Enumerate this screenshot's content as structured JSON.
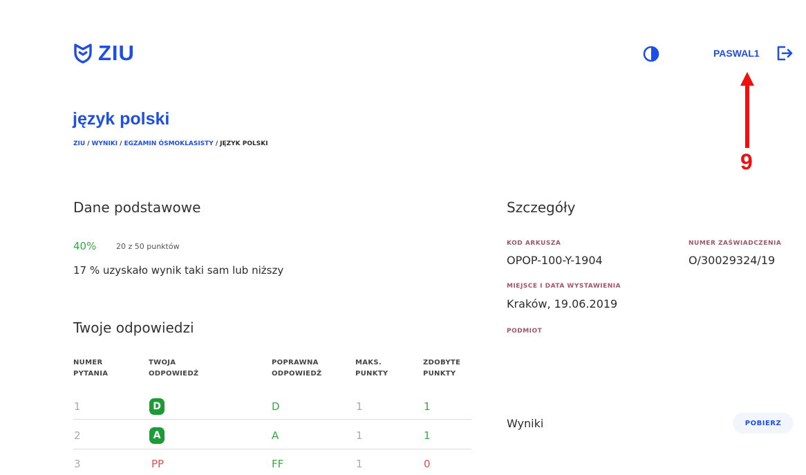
{
  "header": {
    "logo_text": "ZIU",
    "user_name": "PASWAL1",
    "icons": {
      "logo": "shield-logo-icon",
      "contrast": "contrast-icon",
      "logout": "logout-icon"
    },
    "accent_color": "#1f4fe0"
  },
  "annotation": {
    "number": "9",
    "color": "#ee1111"
  },
  "page": {
    "title": "język polski",
    "breadcrumb": [
      "ZIU",
      "WYNIKI",
      "EGZAMIN ÓSMOKLASISTY",
      "JĘZYK POLSKI"
    ],
    "breadcrumb_sep": "/"
  },
  "basic": {
    "heading": "Dane podstawowe",
    "percent": "40%",
    "points": "20 z 50 punktów",
    "stat": "17 % uzyskało wynik taki sam lub niższy"
  },
  "answers": {
    "heading": "Twoje odpowiedzi",
    "columns": [
      [
        "NUMER",
        "PYTANIA"
      ],
      [
        "TWOJA",
        "ODPOWIEDŹ"
      ],
      [
        "POPRAWNA",
        "ODPOWIEDŹ"
      ],
      [
        "MAKS.",
        "PUNKTY"
      ],
      [
        "ZDOBYTE",
        "PUNKTY"
      ]
    ],
    "rows": [
      {
        "num": "1",
        "answer": "D",
        "correct": "D",
        "max": "1",
        "scored": "1"
      },
      {
        "num": "2",
        "answer": "A",
        "correct": "A",
        "max": "1",
        "scored": "1"
      },
      {
        "num": "3",
        "answer": "PP",
        "correct": "FF",
        "max": "1",
        "scored": "0"
      }
    ],
    "colors": {
      "correct": "#33aa44",
      "wrong": "#e05050",
      "badge": "#1e9a38"
    }
  },
  "details": {
    "heading": "Szczegóły",
    "kod_label": "KOD ARKUSZA",
    "kod_value": "OPOP-100-Y-1904",
    "numer_label": "NUMER ZAŚWIADCZENIA",
    "numer_value": "O/30029324/19",
    "miejsce_label": "MIEJSCE I DATA WYSTAWIENIA",
    "miejsce_value": "Kraków, 19.06.2019",
    "podmiot_label": "PODMIOT",
    "label_color": "#a0566a"
  },
  "results": {
    "label": "Wyniki",
    "download_label": "POBIERZ"
  }
}
